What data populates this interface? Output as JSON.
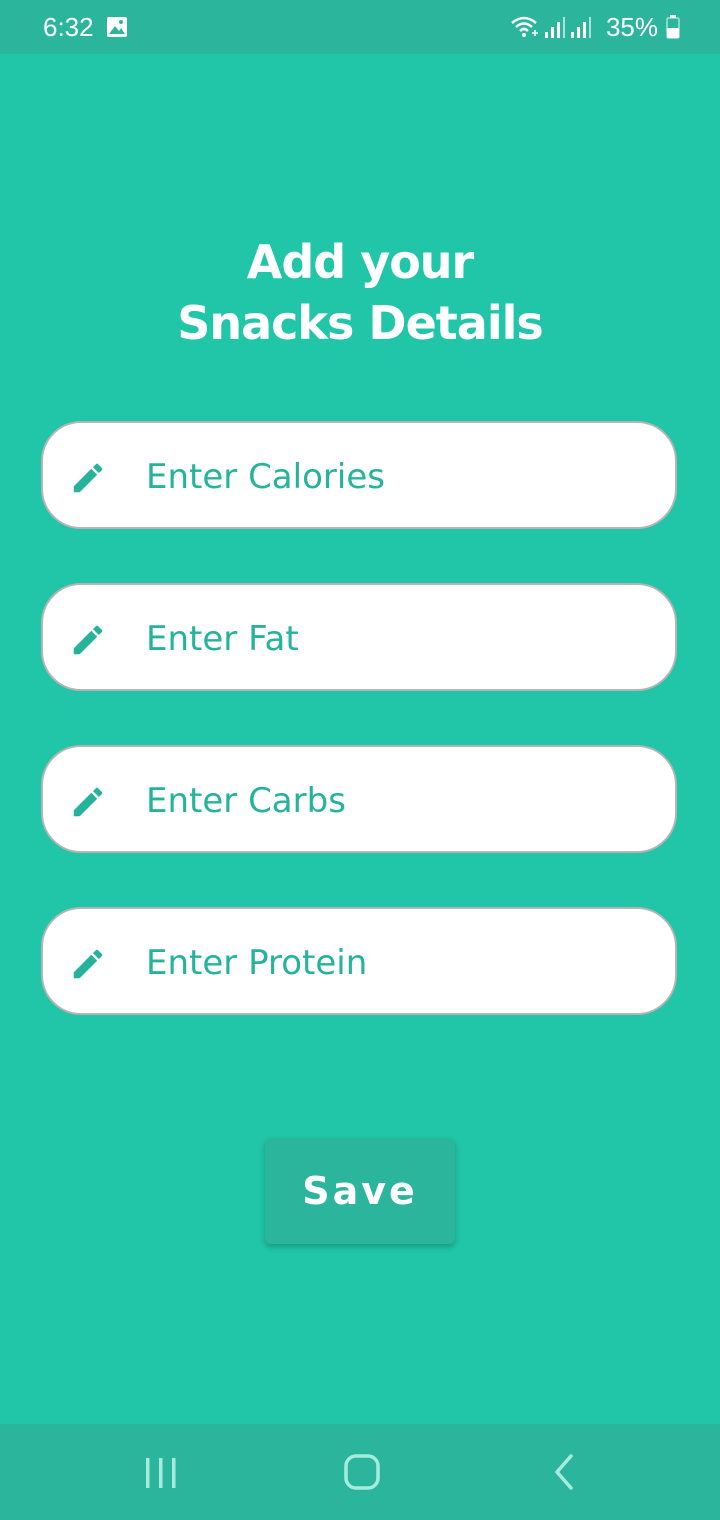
{
  "status_bar": {
    "time": "6:32",
    "battery": "35%",
    "icons": [
      "image-icon",
      "wifi-icon",
      "signal-icon",
      "signal-icon",
      "battery-icon"
    ]
  },
  "title": {
    "line1": "Add your",
    "line2": "Snacks Details"
  },
  "fields": [
    {
      "placeholder": "Enter Calories",
      "value": "",
      "icon": "pencil-icon"
    },
    {
      "placeholder": "Enter Fat",
      "value": "",
      "icon": "pencil-icon"
    },
    {
      "placeholder": "Enter Carbs",
      "value": "",
      "icon": "pencil-icon"
    },
    {
      "placeholder": "Enter Protein",
      "value": "",
      "icon": "pencil-icon"
    }
  ],
  "save_button": {
    "label": "Save"
  },
  "nav_bar": {
    "buttons": [
      "recents-icon",
      "home-icon",
      "back-icon"
    ]
  },
  "colors": {
    "background": "#21c5a8",
    "bars": "#2bb59d",
    "accent_text": "#26b39b",
    "field_bg": "#ffffff"
  }
}
